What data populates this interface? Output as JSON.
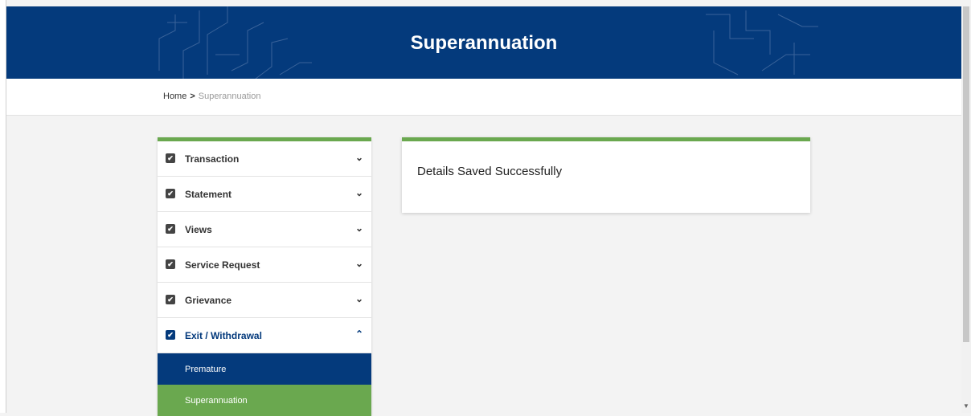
{
  "header": {
    "title": "Superannuation",
    "bg_color": "#043a7c"
  },
  "breadcrumb": {
    "home": "Home",
    "separator": ">",
    "current": "Superannuation"
  },
  "sidebar": {
    "accent_color": "#6aa84f",
    "items": [
      {
        "label": "Transaction",
        "icon": "checkbox-icon",
        "chevron": "chevron-down-icon"
      },
      {
        "label": "Statement",
        "icon": "checkbox-icon",
        "chevron": "chevron-down-icon"
      },
      {
        "label": "Views",
        "icon": "checkbox-icon",
        "chevron": "chevron-down-icon"
      },
      {
        "label": "Service Request",
        "icon": "checkbox-icon",
        "chevron": "chevron-down-icon"
      },
      {
        "label": "Grievance",
        "icon": "checkbox-icon",
        "chevron": "chevron-down-icon"
      },
      {
        "label": "Exit / Withdrawal",
        "icon": "checkbox-icon",
        "chevron": "chevron-up-icon",
        "expanded": true
      }
    ],
    "subitems": [
      {
        "label": "Premature",
        "color": "#043a7c"
      },
      {
        "label": "Superannuation",
        "color": "#6aa84f"
      }
    ]
  },
  "card": {
    "message": "Details Saved Successfully"
  }
}
